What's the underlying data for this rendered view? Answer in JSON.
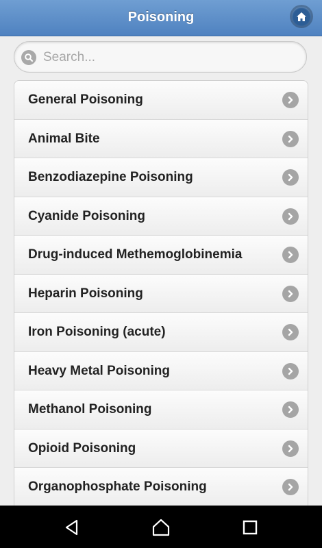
{
  "header": {
    "title": "Poisoning",
    "home_icon": "home-icon"
  },
  "search": {
    "placeholder": "Search...",
    "value": "",
    "icon": "search-icon"
  },
  "list": {
    "items": [
      {
        "label": "General Poisoning"
      },
      {
        "label": "Animal Bite"
      },
      {
        "label": "Benzodiazepine Poisoning"
      },
      {
        "label": "Cyanide Poisoning"
      },
      {
        "label": "Drug-induced Methemoglobinemia"
      },
      {
        "label": "Heparin Poisoning"
      },
      {
        "label": "Iron Poisoning (acute)"
      },
      {
        "label": "Heavy Metal Poisoning"
      },
      {
        "label": "Methanol Poisoning"
      },
      {
        "label": "Opioid Poisoning"
      },
      {
        "label": "Organophosphate Poisoning"
      }
    ],
    "item_icon": "chevron-right-icon"
  },
  "navbar": {
    "back_icon": "back-triangle-icon",
    "home_icon": "home-outline-icon",
    "recents_icon": "recents-square-icon"
  },
  "colors": {
    "header": "#5a8cc8",
    "accent": "#2c5d95",
    "text": "#222222",
    "navbar": "#000000"
  }
}
